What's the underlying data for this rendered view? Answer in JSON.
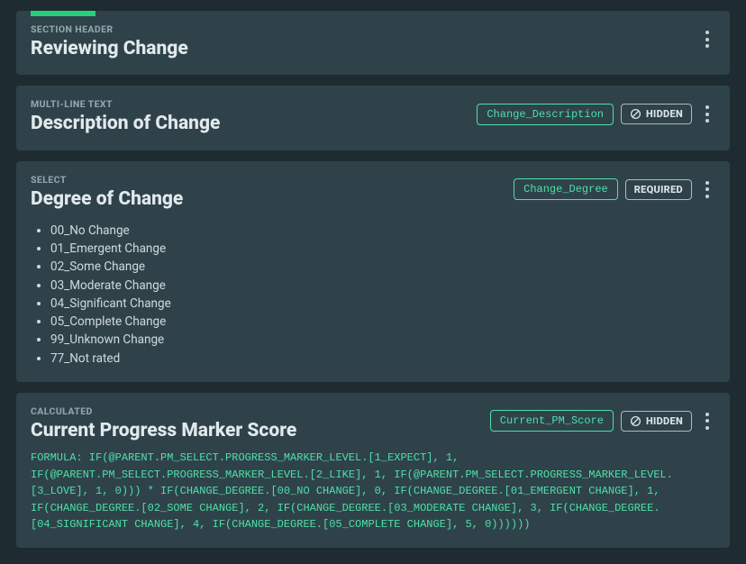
{
  "cards": [
    {
      "type_label": "SECTION HEADER",
      "title": "Reviewing Change",
      "accent": true
    },
    {
      "type_label": "MULTI-LINE TEXT",
      "title": "Description of Change",
      "identifier": "Change_Description",
      "status": "HIDDEN"
    },
    {
      "type_label": "SELECT",
      "title": "Degree of Change",
      "identifier": "Change_Degree",
      "status": "REQUIRED",
      "options": [
        "00_No Change",
        "01_Emergent Change",
        "02_Some Change",
        "03_Moderate Change",
        "04_Significant Change",
        "05_Complete Change",
        "99_Unknown Change",
        "77_Not rated"
      ]
    },
    {
      "type_label": "CALCULATED",
      "title": "Current Progress Marker Score",
      "identifier": "Current_PM_Score",
      "status": "HIDDEN",
      "formula": "FORMULA: IF(@PARENT.PM_SELECT.PROGRESS_MARKER_LEVEL.[1_EXPECT], 1, IF(@PARENT.PM_SELECT.PROGRESS_MARKER_LEVEL.[2_LIKE], 1, IF(@PARENT.PM_SELECT.PROGRESS_MARKER_LEVEL.[3_LOVE], 1, 0))) * IF(CHANGE_DEGREE.[00_NO CHANGE], 0, IF(CHANGE_DEGREE.[01_EMERGENT CHANGE], 1, IF(CHANGE_DEGREE.[02_SOME CHANGE], 2, IF(CHANGE_DEGREE.[03_MODERATE CHANGE], 3, IF(CHANGE_DEGREE.[04_SIGNIFICANT CHANGE], 4, IF(CHANGE_DEGREE.[05_COMPLETE CHANGE], 5, 0))))))"
    }
  ]
}
